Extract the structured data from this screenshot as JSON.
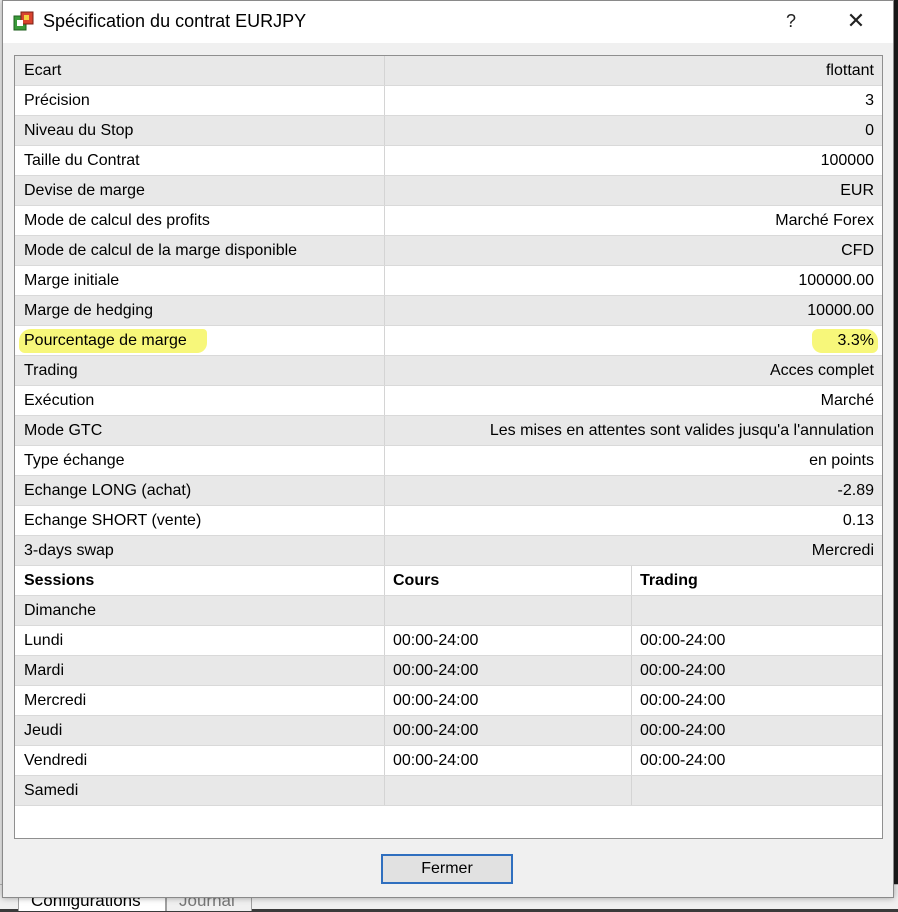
{
  "window": {
    "title": "Spécification du contrat EURJPY",
    "help_label": "?",
    "close_label": "✕"
  },
  "spec_rows": [
    {
      "label": "Ecart",
      "value": "flottant"
    },
    {
      "label": "Précision",
      "value": "3"
    },
    {
      "label": "Niveau du Stop",
      "value": "0"
    },
    {
      "label": "Taille du Contrat",
      "value": "100000"
    },
    {
      "label": "Devise de marge",
      "value": "EUR"
    },
    {
      "label": "Mode de calcul des profits",
      "value": "Marché Forex"
    },
    {
      "label": "Mode de calcul de la marge disponible",
      "value": "CFD"
    },
    {
      "label": "Marge initiale",
      "value": "100000.00"
    },
    {
      "label": "Marge de hedging",
      "value": "10000.00"
    },
    {
      "label": "Pourcentage de marge",
      "value": "3.3%"
    },
    {
      "label": "Trading",
      "value": "Acces complet"
    },
    {
      "label": "Exécution",
      "value": "Marché"
    },
    {
      "label": "Mode GTC",
      "value": "Les mises en attentes sont valides jusqu'a l'annulation"
    },
    {
      "label": "Type échange",
      "value": "en points"
    },
    {
      "label": "Echange LONG (achat)",
      "value": "-2.89"
    },
    {
      "label": "Echange SHORT (vente)",
      "value": "0.13"
    },
    {
      "label": "3-days swap",
      "value": "Mercredi"
    }
  ],
  "sessions": {
    "headers": [
      "Sessions",
      "Cours",
      "Trading"
    ],
    "rows": [
      {
        "day": "Dimanche",
        "cours": "",
        "trading": ""
      },
      {
        "day": "Lundi",
        "cours": "00:00-24:00",
        "trading": "00:00-24:00"
      },
      {
        "day": "Mardi",
        "cours": "00:00-24:00",
        "trading": "00:00-24:00"
      },
      {
        "day": "Mercredi",
        "cours": "00:00-24:00",
        "trading": "00:00-24:00"
      },
      {
        "day": "Jeudi",
        "cours": "00:00-24:00",
        "trading": "00:00-24:00"
      },
      {
        "day": "Vendredi",
        "cours": "00:00-24:00",
        "trading": "00:00-24:00"
      },
      {
        "day": "Samedi",
        "cours": "",
        "trading": ""
      }
    ]
  },
  "footer": {
    "close_button_label": "Fermer"
  },
  "background_tabs": [
    "Configurations",
    "Journal"
  ],
  "colors": {
    "highlight": "#f7f77a",
    "alt_row": "#e8e8e8",
    "button_border": "#2f6fbf"
  }
}
